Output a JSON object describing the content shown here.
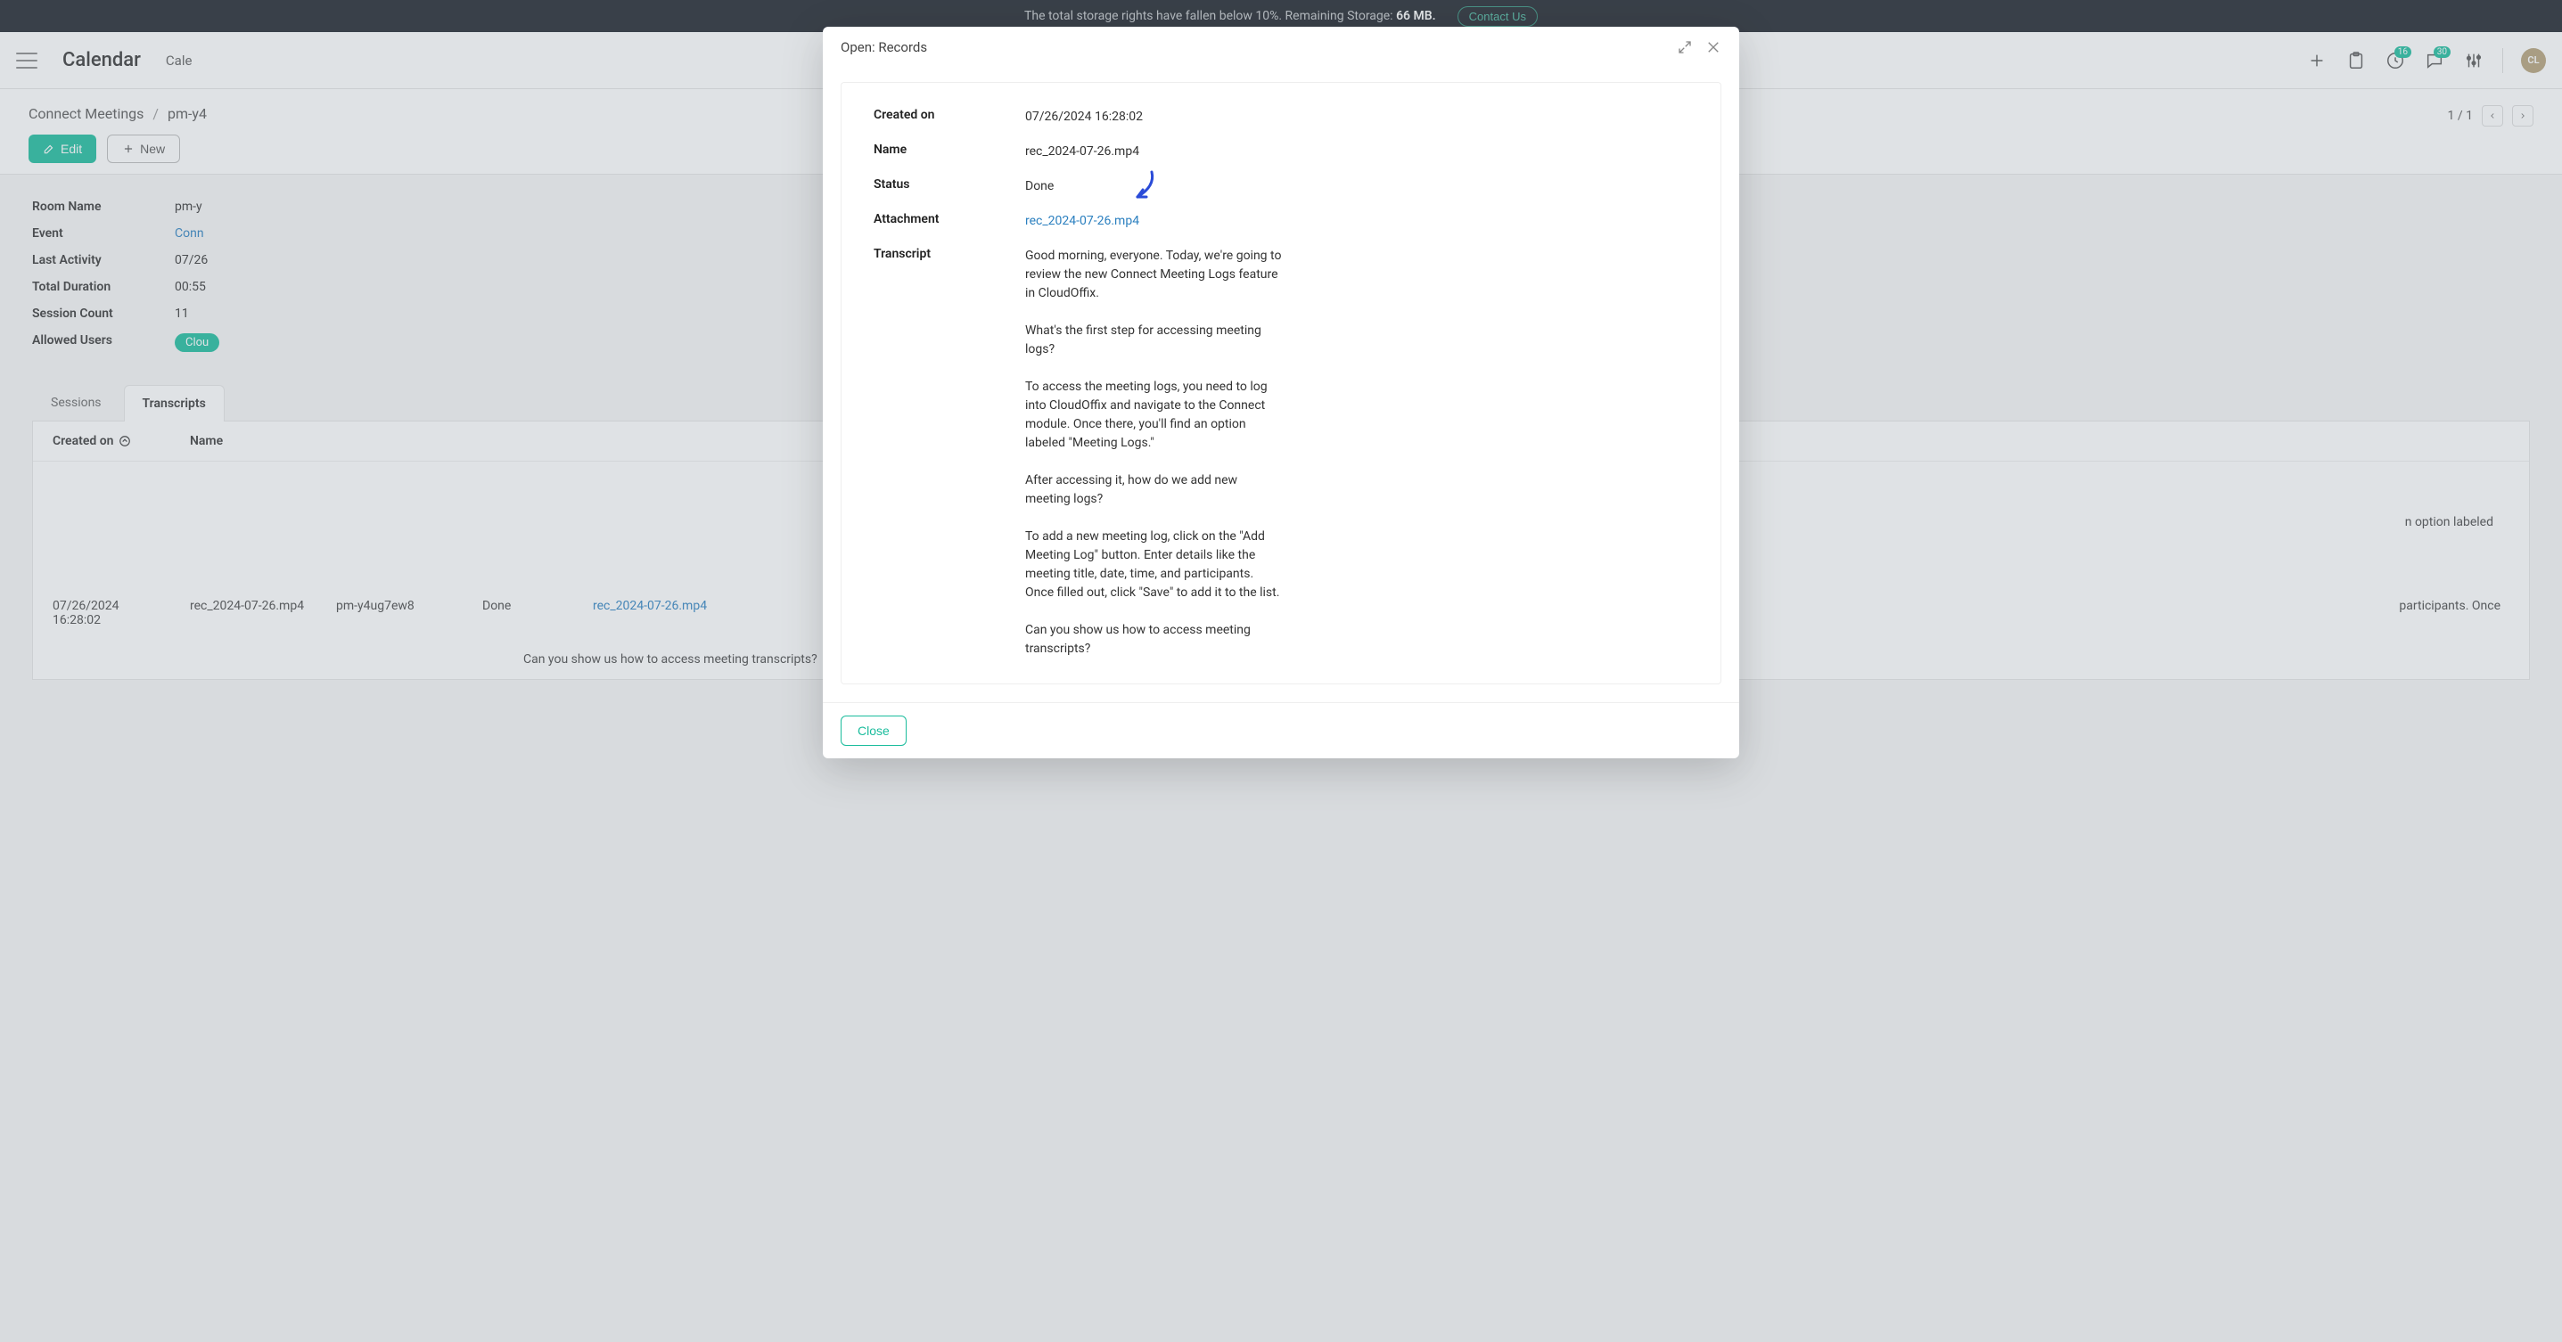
{
  "storage_bar": {
    "text_prefix": "The total storage rights have fallen below 10%. Remaining Storage: ",
    "remaining": "66 MB.",
    "contact_label": "Contact Us"
  },
  "header": {
    "app_title": "Calendar",
    "nav_item": "Cale",
    "badges": {
      "clock": "16",
      "chat": "30"
    },
    "avatar_initials": "CL"
  },
  "subheader": {
    "crumb1": "Connect Meetings",
    "crumb2": "pm-y4",
    "edit_label": "Edit",
    "new_label": "New",
    "pager": "1 / 1"
  },
  "details": {
    "room_name_label": "Room Name",
    "room_name_val": "pm-y",
    "event_label": "Event",
    "event_val": "Conn",
    "last_activity_label": "Last Activity",
    "last_activity_val": "07/26",
    "total_duration_label": "Total Duration",
    "total_duration_val": "00:55",
    "session_count_label": "Session Count",
    "session_count_val": "11",
    "allowed_users_label": "Allowed Users",
    "allowed_users_val": "Clou"
  },
  "tabs": {
    "sessions": "Sessions",
    "transcripts": "Transcripts"
  },
  "table": {
    "col_created": "Created on",
    "col_name": "Name",
    "row": {
      "created": "07/26/2024 16:28:02",
      "name": "rec_2024-07-26.mp4",
      "room": "pm-y4ug7ew8",
      "status": "Done",
      "attach": "rec_2024-07-26.mp4"
    },
    "transcript_tail1": "n option labeled",
    "transcript_tail2": "participants. Once",
    "transcript_tail3": "Can you show us how to access meeting transcripts?"
  },
  "modal": {
    "title": "Open: Records",
    "created_on_label": "Created on",
    "created_on_val": "07/26/2024 16:28:02",
    "name_label": "Name",
    "name_val": "rec_2024-07-26.mp4",
    "status_label": "Status",
    "status_val": "Done",
    "attachment_label": "Attachment",
    "attachment_val": "rec_2024-07-26.mp4",
    "transcript_label": "Transcript",
    "transcript_val": "Good morning, everyone. Today, we're going to review the new Connect Meeting Logs feature in CloudOffix.\n\nWhat's the first step for accessing meeting logs?\n\nTo access the meeting logs, you need to log into CloudOffix and navigate to the Connect module. Once there, you'll find an option labeled \"Meeting Logs.\"\n\nAfter accessing it, how do we add new meeting logs?\n\nTo add a new meeting log, click on the \"Add Meeting Log\" button. Enter details like the meeting title, date, time, and participants. Once filled out, click \"Save\" to add it to the list.\n\nCan you show us how to access meeting transcripts?",
    "close_label": "Close"
  }
}
